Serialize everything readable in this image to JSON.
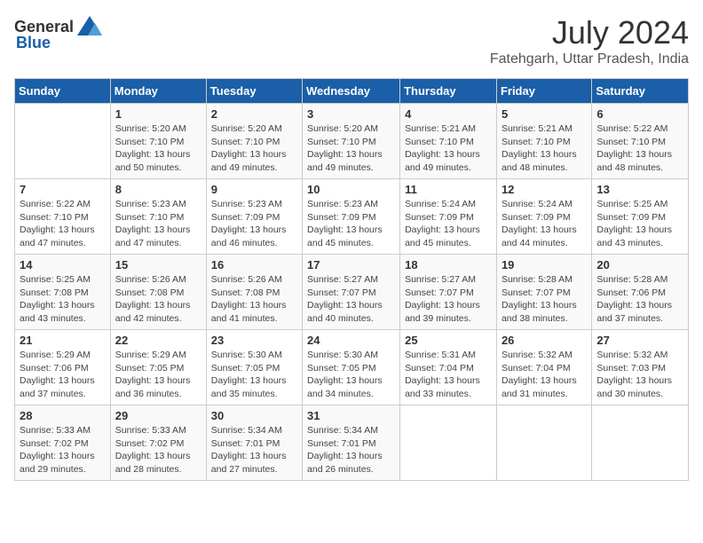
{
  "header": {
    "logo_general": "General",
    "logo_blue": "Blue",
    "month_year": "July 2024",
    "location": "Fatehgarh, Uttar Pradesh, India"
  },
  "days_of_week": [
    "Sunday",
    "Monday",
    "Tuesday",
    "Wednesday",
    "Thursday",
    "Friday",
    "Saturday"
  ],
  "weeks": [
    [
      {
        "day": "",
        "sunrise": "",
        "sunset": "",
        "daylight": ""
      },
      {
        "day": "1",
        "sunrise": "5:20 AM",
        "sunset": "7:10 PM",
        "daylight": "13 hours and 50 minutes."
      },
      {
        "day": "2",
        "sunrise": "5:20 AM",
        "sunset": "7:10 PM",
        "daylight": "13 hours and 49 minutes."
      },
      {
        "day": "3",
        "sunrise": "5:20 AM",
        "sunset": "7:10 PM",
        "daylight": "13 hours and 49 minutes."
      },
      {
        "day": "4",
        "sunrise": "5:21 AM",
        "sunset": "7:10 PM",
        "daylight": "13 hours and 49 minutes."
      },
      {
        "day": "5",
        "sunrise": "5:21 AM",
        "sunset": "7:10 PM",
        "daylight": "13 hours and 48 minutes."
      },
      {
        "day": "6",
        "sunrise": "5:22 AM",
        "sunset": "7:10 PM",
        "daylight": "13 hours and 48 minutes."
      }
    ],
    [
      {
        "day": "7",
        "sunrise": "5:22 AM",
        "sunset": "7:10 PM",
        "daylight": "13 hours and 47 minutes."
      },
      {
        "day": "8",
        "sunrise": "5:23 AM",
        "sunset": "7:10 PM",
        "daylight": "13 hours and 47 minutes."
      },
      {
        "day": "9",
        "sunrise": "5:23 AM",
        "sunset": "7:09 PM",
        "daylight": "13 hours and 46 minutes."
      },
      {
        "day": "10",
        "sunrise": "5:23 AM",
        "sunset": "7:09 PM",
        "daylight": "13 hours and 45 minutes."
      },
      {
        "day": "11",
        "sunrise": "5:24 AM",
        "sunset": "7:09 PM",
        "daylight": "13 hours and 45 minutes."
      },
      {
        "day": "12",
        "sunrise": "5:24 AM",
        "sunset": "7:09 PM",
        "daylight": "13 hours and 44 minutes."
      },
      {
        "day": "13",
        "sunrise": "5:25 AM",
        "sunset": "7:09 PM",
        "daylight": "13 hours and 43 minutes."
      }
    ],
    [
      {
        "day": "14",
        "sunrise": "5:25 AM",
        "sunset": "7:08 PM",
        "daylight": "13 hours and 43 minutes."
      },
      {
        "day": "15",
        "sunrise": "5:26 AM",
        "sunset": "7:08 PM",
        "daylight": "13 hours and 42 minutes."
      },
      {
        "day": "16",
        "sunrise": "5:26 AM",
        "sunset": "7:08 PM",
        "daylight": "13 hours and 41 minutes."
      },
      {
        "day": "17",
        "sunrise": "5:27 AM",
        "sunset": "7:07 PM",
        "daylight": "13 hours and 40 minutes."
      },
      {
        "day": "18",
        "sunrise": "5:27 AM",
        "sunset": "7:07 PM",
        "daylight": "13 hours and 39 minutes."
      },
      {
        "day": "19",
        "sunrise": "5:28 AM",
        "sunset": "7:07 PM",
        "daylight": "13 hours and 38 minutes."
      },
      {
        "day": "20",
        "sunrise": "5:28 AM",
        "sunset": "7:06 PM",
        "daylight": "13 hours and 37 minutes."
      }
    ],
    [
      {
        "day": "21",
        "sunrise": "5:29 AM",
        "sunset": "7:06 PM",
        "daylight": "13 hours and 37 minutes."
      },
      {
        "day": "22",
        "sunrise": "5:29 AM",
        "sunset": "7:05 PM",
        "daylight": "13 hours and 36 minutes."
      },
      {
        "day": "23",
        "sunrise": "5:30 AM",
        "sunset": "7:05 PM",
        "daylight": "13 hours and 35 minutes."
      },
      {
        "day": "24",
        "sunrise": "5:30 AM",
        "sunset": "7:05 PM",
        "daylight": "13 hours and 34 minutes."
      },
      {
        "day": "25",
        "sunrise": "5:31 AM",
        "sunset": "7:04 PM",
        "daylight": "13 hours and 33 minutes."
      },
      {
        "day": "26",
        "sunrise": "5:32 AM",
        "sunset": "7:04 PM",
        "daylight": "13 hours and 31 minutes."
      },
      {
        "day": "27",
        "sunrise": "5:32 AM",
        "sunset": "7:03 PM",
        "daylight": "13 hours and 30 minutes."
      }
    ],
    [
      {
        "day": "28",
        "sunrise": "5:33 AM",
        "sunset": "7:02 PM",
        "daylight": "13 hours and 29 minutes."
      },
      {
        "day": "29",
        "sunrise": "5:33 AM",
        "sunset": "7:02 PM",
        "daylight": "13 hours and 28 minutes."
      },
      {
        "day": "30",
        "sunrise": "5:34 AM",
        "sunset": "7:01 PM",
        "daylight": "13 hours and 27 minutes."
      },
      {
        "day": "31",
        "sunrise": "5:34 AM",
        "sunset": "7:01 PM",
        "daylight": "13 hours and 26 minutes."
      },
      {
        "day": "",
        "sunrise": "",
        "sunset": "",
        "daylight": ""
      },
      {
        "day": "",
        "sunrise": "",
        "sunset": "",
        "daylight": ""
      },
      {
        "day": "",
        "sunrise": "",
        "sunset": "",
        "daylight": ""
      }
    ]
  ],
  "labels": {
    "sunrise_prefix": "Sunrise: ",
    "sunset_prefix": "Sunset: ",
    "daylight_prefix": "Daylight: "
  }
}
